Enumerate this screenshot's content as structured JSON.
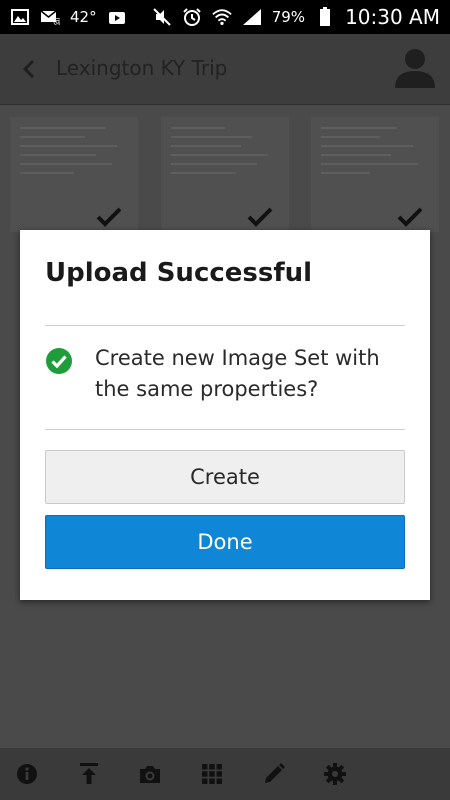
{
  "status_bar": {
    "temperature": "42°",
    "battery": "79%",
    "time": "10:30 AM",
    "icons_left": [
      "image-icon",
      "mail-icon",
      "temperature",
      "camera-icon"
    ],
    "icons_right": [
      "mute-icon",
      "alarm-icon",
      "wifi-icon",
      "signal-icon",
      "battery-icon"
    ]
  },
  "header": {
    "title": "Lexington KY Trip",
    "back_icon": "back-arrow-icon",
    "avatar_icon": "user-avatar-icon"
  },
  "thumbnails": [
    {
      "name": "receipt-1",
      "selected": true
    },
    {
      "name": "receipt-2",
      "selected": true
    },
    {
      "name": "receipt-3",
      "selected": true
    }
  ],
  "dialog": {
    "title": "Upload Successful",
    "message": "Create new Image Set with the same properties?",
    "create_label": "Create",
    "done_label": "Done"
  },
  "toolbar": {
    "icons": [
      "info-icon",
      "upload-icon",
      "camera-icon",
      "grid-icon",
      "edit-icon",
      "settings-icon"
    ]
  },
  "colors": {
    "accent": "#1087d6",
    "success": "#1f9d3a",
    "overlay": "#4a4a4a"
  }
}
